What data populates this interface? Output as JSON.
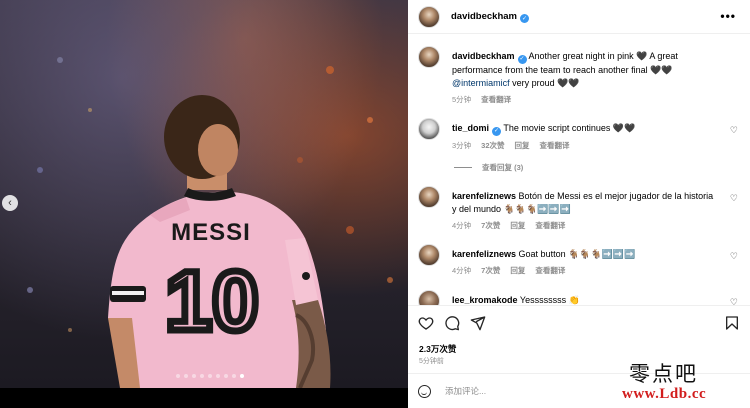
{
  "colors": {
    "shirt_pink": "#f2b9cd",
    "verified_blue": "#3897f0",
    "mention": "#00376b",
    "muted": "#8e8e8e",
    "watermark_red": "#d21d1d"
  },
  "photo": {
    "jersey_name": "MESSI",
    "jersey_number": "10",
    "carousel": {
      "count": 9,
      "active_index": 8
    }
  },
  "post": {
    "author": "davidbeckham",
    "caption_user": "davidbeckham",
    "caption_text_1": "Another great night in pink 🖤 A great performance from the team to reach another final 🖤🖤",
    "caption_mention": "@intermiamicf",
    "caption_text_2": " very proud 🖤🖤",
    "caption_time": "5分钟",
    "caption_translate": "查看翻译"
  },
  "comments": [
    {
      "user": "tie_domi",
      "text": "The movie script continues 🖤🖤",
      "time": "3分钟",
      "likes": "32次赞",
      "reply": "回复",
      "translate": "查看翻译"
    },
    {
      "user": "karenfeliznews",
      "text": "Botón de Messi es el mejor jugador de la historia y del mundo 🐐🐐🐐➡️➡️➡️",
      "time": "4分钟",
      "likes": "7次赞",
      "reply": "回复",
      "translate": "查看翻译"
    },
    {
      "user": "karenfeliznews",
      "text": "Goat button 🐐🐐🐐➡️➡️➡️",
      "time": "4分钟",
      "likes": "7次赞",
      "reply": "回复",
      "translate": "查看翻译"
    },
    {
      "user": "lee_kromakode",
      "text": "Yessssssss 👏"
    }
  ],
  "view_replies": "查看回复 (3)",
  "footer": {
    "likes": "2.3万次赞",
    "time": "5分钟前",
    "comment_placeholder": "添加评论..."
  },
  "watermark": {
    "line1": "零点吧",
    "line2": "www.Ldb.cc"
  },
  "icons": [
    "chevron-left-icon",
    "more-icon",
    "verified-icon",
    "heart-icon",
    "comment-icon",
    "share-icon",
    "bookmark-icon",
    "emoji-icon"
  ]
}
